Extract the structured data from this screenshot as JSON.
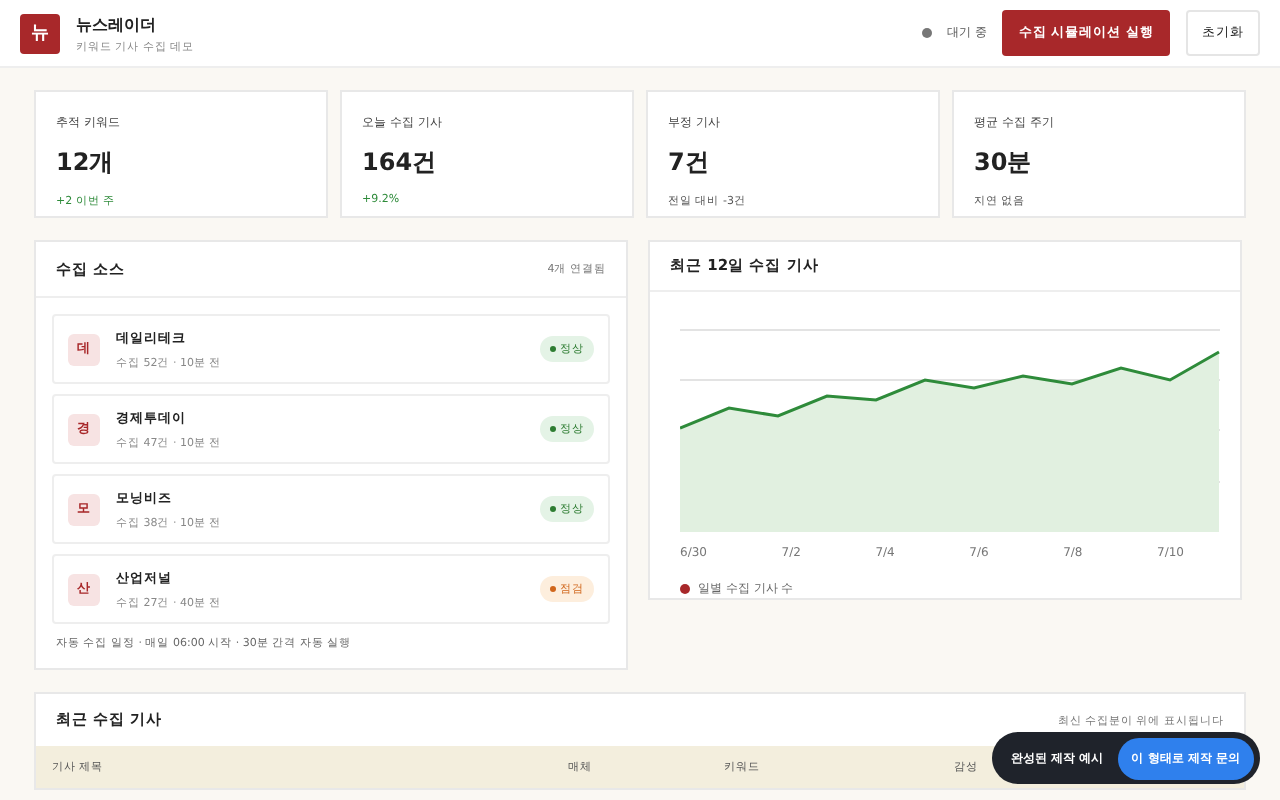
{
  "header": {
    "logo": "뉴",
    "title": "뉴스레이더",
    "subtitle": "키워드 기사 수집 데모",
    "status": "대기 중",
    "primary_button": "수집 시뮬레이션 실행",
    "secondary_button": "초기화"
  },
  "stats": [
    {
      "label": "추적 키워드",
      "value": "12개",
      "note": "+2 이번 주",
      "positive": true
    },
    {
      "label": "오늘 수집 기사",
      "value": "164건",
      "note": "+9.2%",
      "positive": true
    },
    {
      "label": "부정 기사",
      "value": "7건",
      "note": "전일 대비 -3건",
      "positive": false
    },
    {
      "label": "평균 수집 주기",
      "value": "30분",
      "note": "지연 없음",
      "positive": false
    }
  ],
  "sources": {
    "title": "수집 소스",
    "count": "4개 연결됨",
    "items": [
      {
        "initial": "데",
        "name": "데일리테크",
        "meta": "수집 52건 · 10분 전",
        "status": "정상",
        "kind": "ok"
      },
      {
        "initial": "경",
        "name": "경제투데이",
        "meta": "수집 47건 · 10분 전",
        "status": "정상",
        "kind": "ok"
      },
      {
        "initial": "모",
        "name": "모닝비즈",
        "meta": "수집 38건 · 10분 전",
        "status": "정상",
        "kind": "ok"
      },
      {
        "initial": "산",
        "name": "산업저널",
        "meta": "수집 27건 · 40분 전",
        "status": "점검",
        "kind": "warn"
      }
    ],
    "footnote": "자동 수집 일정 · 매일 06:00 시작 · 30분 간격 자동 실행"
  },
  "trend": {
    "title": "최근 12일 수집 기사",
    "x_labels": [
      "6/30",
      "7/2",
      "7/4",
      "7/6",
      "7/8",
      "7/10"
    ],
    "legend": "일별 수집 기사 수"
  },
  "articles": {
    "title": "최근 수집 기사",
    "hint": "최신 수집분이 위에 표시됩니다",
    "columns": [
      "기사 제목",
      "매체",
      "키워드",
      "감성"
    ]
  },
  "promo": {
    "label": "완성된 제작 예시",
    "button": "이 형태로 제작 문의"
  }
}
